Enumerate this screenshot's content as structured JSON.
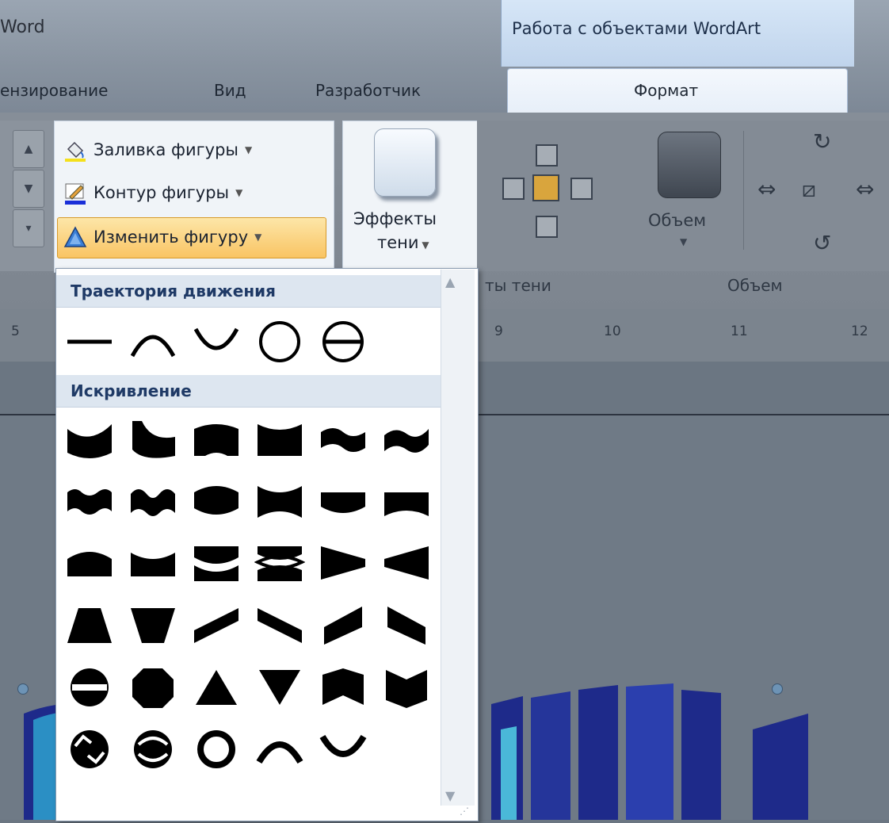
{
  "window": {
    "app_title": "Word"
  },
  "contextual_tab": {
    "title": "Работа с объектами WordArt"
  },
  "tabs": [
    {
      "label": "ензирование"
    },
    {
      "label": "Вид"
    },
    {
      "label": "Разработчик"
    },
    {
      "label": "Формат"
    }
  ],
  "ribbon": {
    "shape_styles": {
      "fill_label": "Заливка фигуры",
      "outline_label": "Контур фигуры",
      "change_label": "Изменить фигуру"
    },
    "shadow_effects": {
      "button_line1": "Эффекты",
      "button_line2": "тени",
      "group_label": "ты тени"
    },
    "volume": {
      "button_label": "Объем",
      "group_label": "Объем"
    }
  },
  "ruler": {
    "ticks": [
      "5",
      "9",
      "10",
      "11",
      "12"
    ]
  },
  "gallery": {
    "section_path": "Траектория движения",
    "section_warp": "Искривление",
    "path_shapes": [
      "straight-line",
      "arch-up",
      "arch-down",
      "circle",
      "button"
    ],
    "warp_shapes": [
      "triangle-up",
      "triangle-down",
      "chevron-up",
      "chevron-down",
      "wave1",
      "wave2",
      "double-wave1",
      "double-wave2",
      "inflate",
      "deflate",
      "inflate-bottom",
      "deflate-bottom",
      "inflate-top",
      "deflate-top",
      "deflate-inflate",
      "deflate-inflate-deflate",
      "fade-right",
      "fade-left",
      "fade-up",
      "fade-down",
      "slant-up",
      "slant-down",
      "cascade-up",
      "cascade-down",
      "circle-pour",
      "octagon",
      "triangle",
      "inverted-triangle",
      "arch-up-pour",
      "arch-down-pour",
      "button-pour",
      "button-pour-2",
      "ring",
      "arch-up-curve",
      "arch-down-curve"
    ]
  },
  "colors": {
    "accent_orange": "#f9c463",
    "header_blue": "#1f3a66",
    "ribbon_gray": "#838b95"
  }
}
